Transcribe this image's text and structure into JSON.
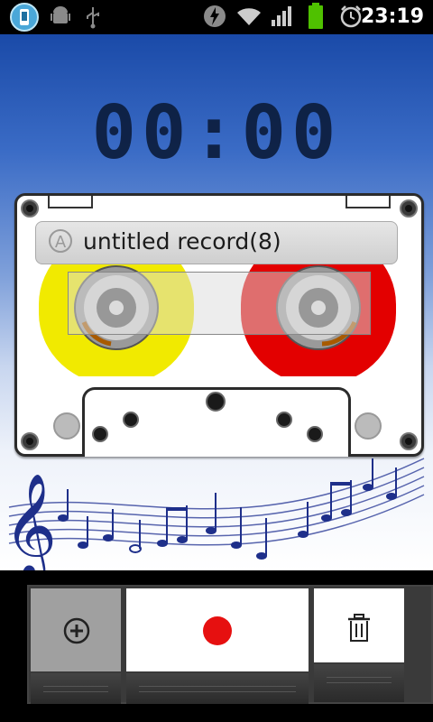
{
  "status_bar": {
    "time": "23:19",
    "icons": [
      "app-icon",
      "android-debug-icon",
      "usb-icon",
      "flash-icon",
      "wifi-icon",
      "signal-icon",
      "battery-icon",
      "alarm-icon"
    ]
  },
  "timer": {
    "display": "00:00"
  },
  "cassette": {
    "label": "untitled record(8)",
    "label_icon": "A"
  },
  "controls": {
    "add": "add-icon",
    "record": "record-icon",
    "delete": "trash-icon"
  },
  "colors": {
    "left_reel": "#f1ea00",
    "right_reel": "#e30000",
    "record": "#e61010",
    "background_top": "#1a4aa8"
  }
}
